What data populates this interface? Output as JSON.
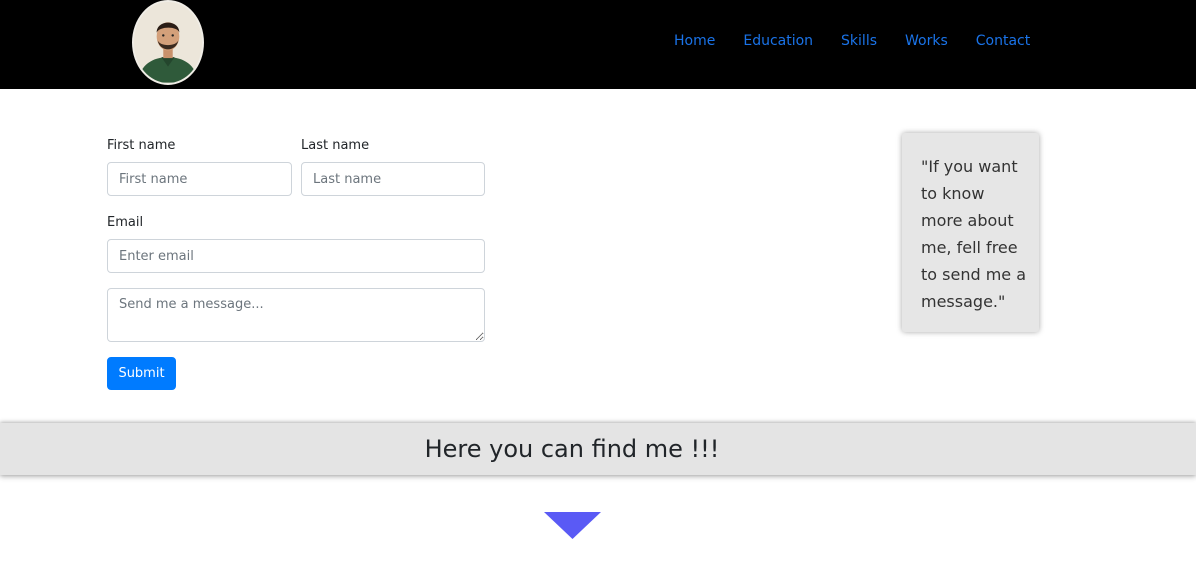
{
  "nav": {
    "links": [
      "Home",
      "Education",
      "Skills",
      "Works",
      "Contact"
    ],
    "link_color": "#1a73e8",
    "background": "#000000"
  },
  "form": {
    "first_name_label": "First name",
    "first_name_placeholder": "First name",
    "last_name_label": "Last name",
    "last_name_placeholder": "Last name",
    "email_label": "Email",
    "email_placeholder": "Enter email",
    "message_placeholder": "Send me a message...",
    "submit_label": "Submit",
    "submit_color": "#007bff"
  },
  "quote": {
    "text": "\"If you want to know more about me, fell free to send me a message.\""
  },
  "banner": {
    "title": "Here you can find me !!!"
  },
  "icons": {
    "avatar": "profile-photo",
    "arrow": "down-triangle-icon",
    "arrow_color": "#5a5af5"
  }
}
